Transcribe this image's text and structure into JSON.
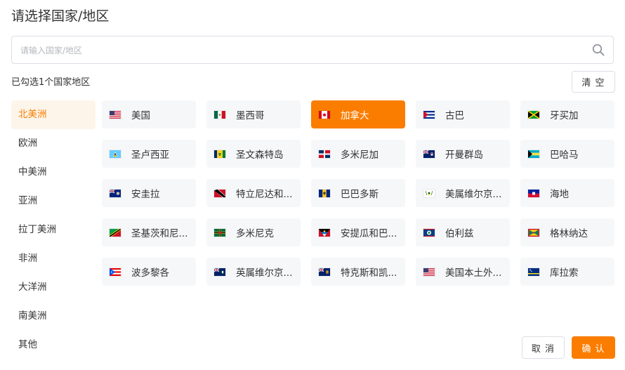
{
  "title": "请选择国家/地区",
  "search": {
    "placeholder": "请输入国家/地区",
    "value": "",
    "icon": "search-icon"
  },
  "selected_count": "已勾选1个国家地区",
  "clear_label": "清 空",
  "regions": [
    {
      "label": "北美洲",
      "active": true
    },
    {
      "label": "欧洲",
      "active": false
    },
    {
      "label": "中美洲",
      "active": false
    },
    {
      "label": "亚洲",
      "active": false
    },
    {
      "label": "拉丁美洲",
      "active": false
    },
    {
      "label": "非洲",
      "active": false
    },
    {
      "label": "大洋洲",
      "active": false
    },
    {
      "label": "南美洲",
      "active": false
    },
    {
      "label": "其他",
      "active": false
    }
  ],
  "countries": [
    {
      "name": "美国",
      "flag": "us",
      "active": false
    },
    {
      "name": "墨西哥",
      "flag": "mx",
      "active": false
    },
    {
      "name": "加拿大",
      "flag": "ca",
      "active": true
    },
    {
      "name": "古巴",
      "flag": "cu",
      "active": false
    },
    {
      "name": "牙买加",
      "flag": "jm",
      "active": false
    },
    {
      "name": "圣卢西亚",
      "flag": "lc",
      "active": false
    },
    {
      "name": "圣文森特岛",
      "flag": "vc",
      "active": false
    },
    {
      "name": "多米尼加",
      "flag": "do",
      "active": false
    },
    {
      "name": "开曼群岛",
      "flag": "ky",
      "active": false
    },
    {
      "name": "巴哈马",
      "flag": "bs",
      "active": false
    },
    {
      "name": "安圭拉",
      "flag": "ai",
      "active": false
    },
    {
      "name": "特立尼达和...",
      "flag": "tt",
      "active": false
    },
    {
      "name": "巴巴多斯",
      "flag": "bb",
      "active": false
    },
    {
      "name": "美属维尔京...",
      "flag": "vi",
      "active": false
    },
    {
      "name": "海地",
      "flag": "ht",
      "active": false
    },
    {
      "name": "圣基茨和尼...",
      "flag": "kn",
      "active": false
    },
    {
      "name": "多米尼克",
      "flag": "dm",
      "active": false
    },
    {
      "name": "安提瓜和巴...",
      "flag": "ag",
      "active": false
    },
    {
      "name": "伯利兹",
      "flag": "bz",
      "active": false
    },
    {
      "name": "格林纳达",
      "flag": "gd",
      "active": false
    },
    {
      "name": "波多黎各",
      "flag": "pr",
      "active": false
    },
    {
      "name": "英属维尔京...",
      "flag": "vg",
      "active": false
    },
    {
      "name": "特克斯和凯...",
      "flag": "tc",
      "active": false
    },
    {
      "name": "美国本土外...",
      "flag": "um",
      "active": false
    },
    {
      "name": "库拉索",
      "flag": "cw",
      "active": false
    }
  ],
  "buttons": {
    "cancel": "取 消",
    "confirm": "确 认"
  },
  "colors": {
    "accent": "#fa7d00",
    "active_side_bg": "#fdf5ea",
    "cell_bg": "#f6f7f9"
  }
}
